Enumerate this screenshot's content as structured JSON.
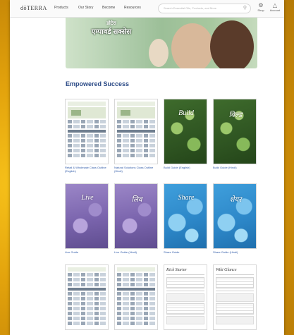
{
  "header": {
    "logo": "dōTERRA",
    "nav": [
      "Products",
      "Our Story",
      "Become",
      "Resources"
    ],
    "search_placeholder": "Search Essential Oils, Products, and More",
    "utilities": [
      {
        "label": "Shop",
        "icon": "gear-icon"
      },
      {
        "label": "Account",
        "icon": "user-icon"
      }
    ]
  },
  "hero": {
    "subtitle": "डोटेरा",
    "title": "एम्पावर्ड सक्सेस"
  },
  "section": {
    "title": "Empowered Success"
  },
  "cards": [
    {
      "caption": "Retail & Wholesale Class Outline (English)",
      "style": "doc"
    },
    {
      "caption": "Natural Solutions Class Outline (Hindi)",
      "style": "doc"
    },
    {
      "caption": "Build Guide (English)",
      "style": "green",
      "script": "Build"
    },
    {
      "caption": "Build Guide (Hindi)",
      "style": "green",
      "script": "बिल्ड"
    },
    {
      "caption": "Live Guide",
      "style": "lav",
      "script": "Live"
    },
    {
      "caption": "Live Guide (Hindi)",
      "style": "lav",
      "script": "लिव"
    },
    {
      "caption": "Share Guide",
      "style": "blue",
      "script": "Share"
    },
    {
      "caption": "Share Guide (Hindi)",
      "style": "blue",
      "script": "शेयर"
    },
    {
      "caption": "",
      "style": "doc"
    },
    {
      "caption": "",
      "style": "doc"
    },
    {
      "caption": "",
      "style": "form",
      "script": "Kick Starter"
    },
    {
      "caption": "",
      "style": "form",
      "script": "Wiki Glance"
    }
  ],
  "colors": {
    "accent": "#2b4a86",
    "link": "#2f5aa8",
    "background": "#e2a20c"
  }
}
